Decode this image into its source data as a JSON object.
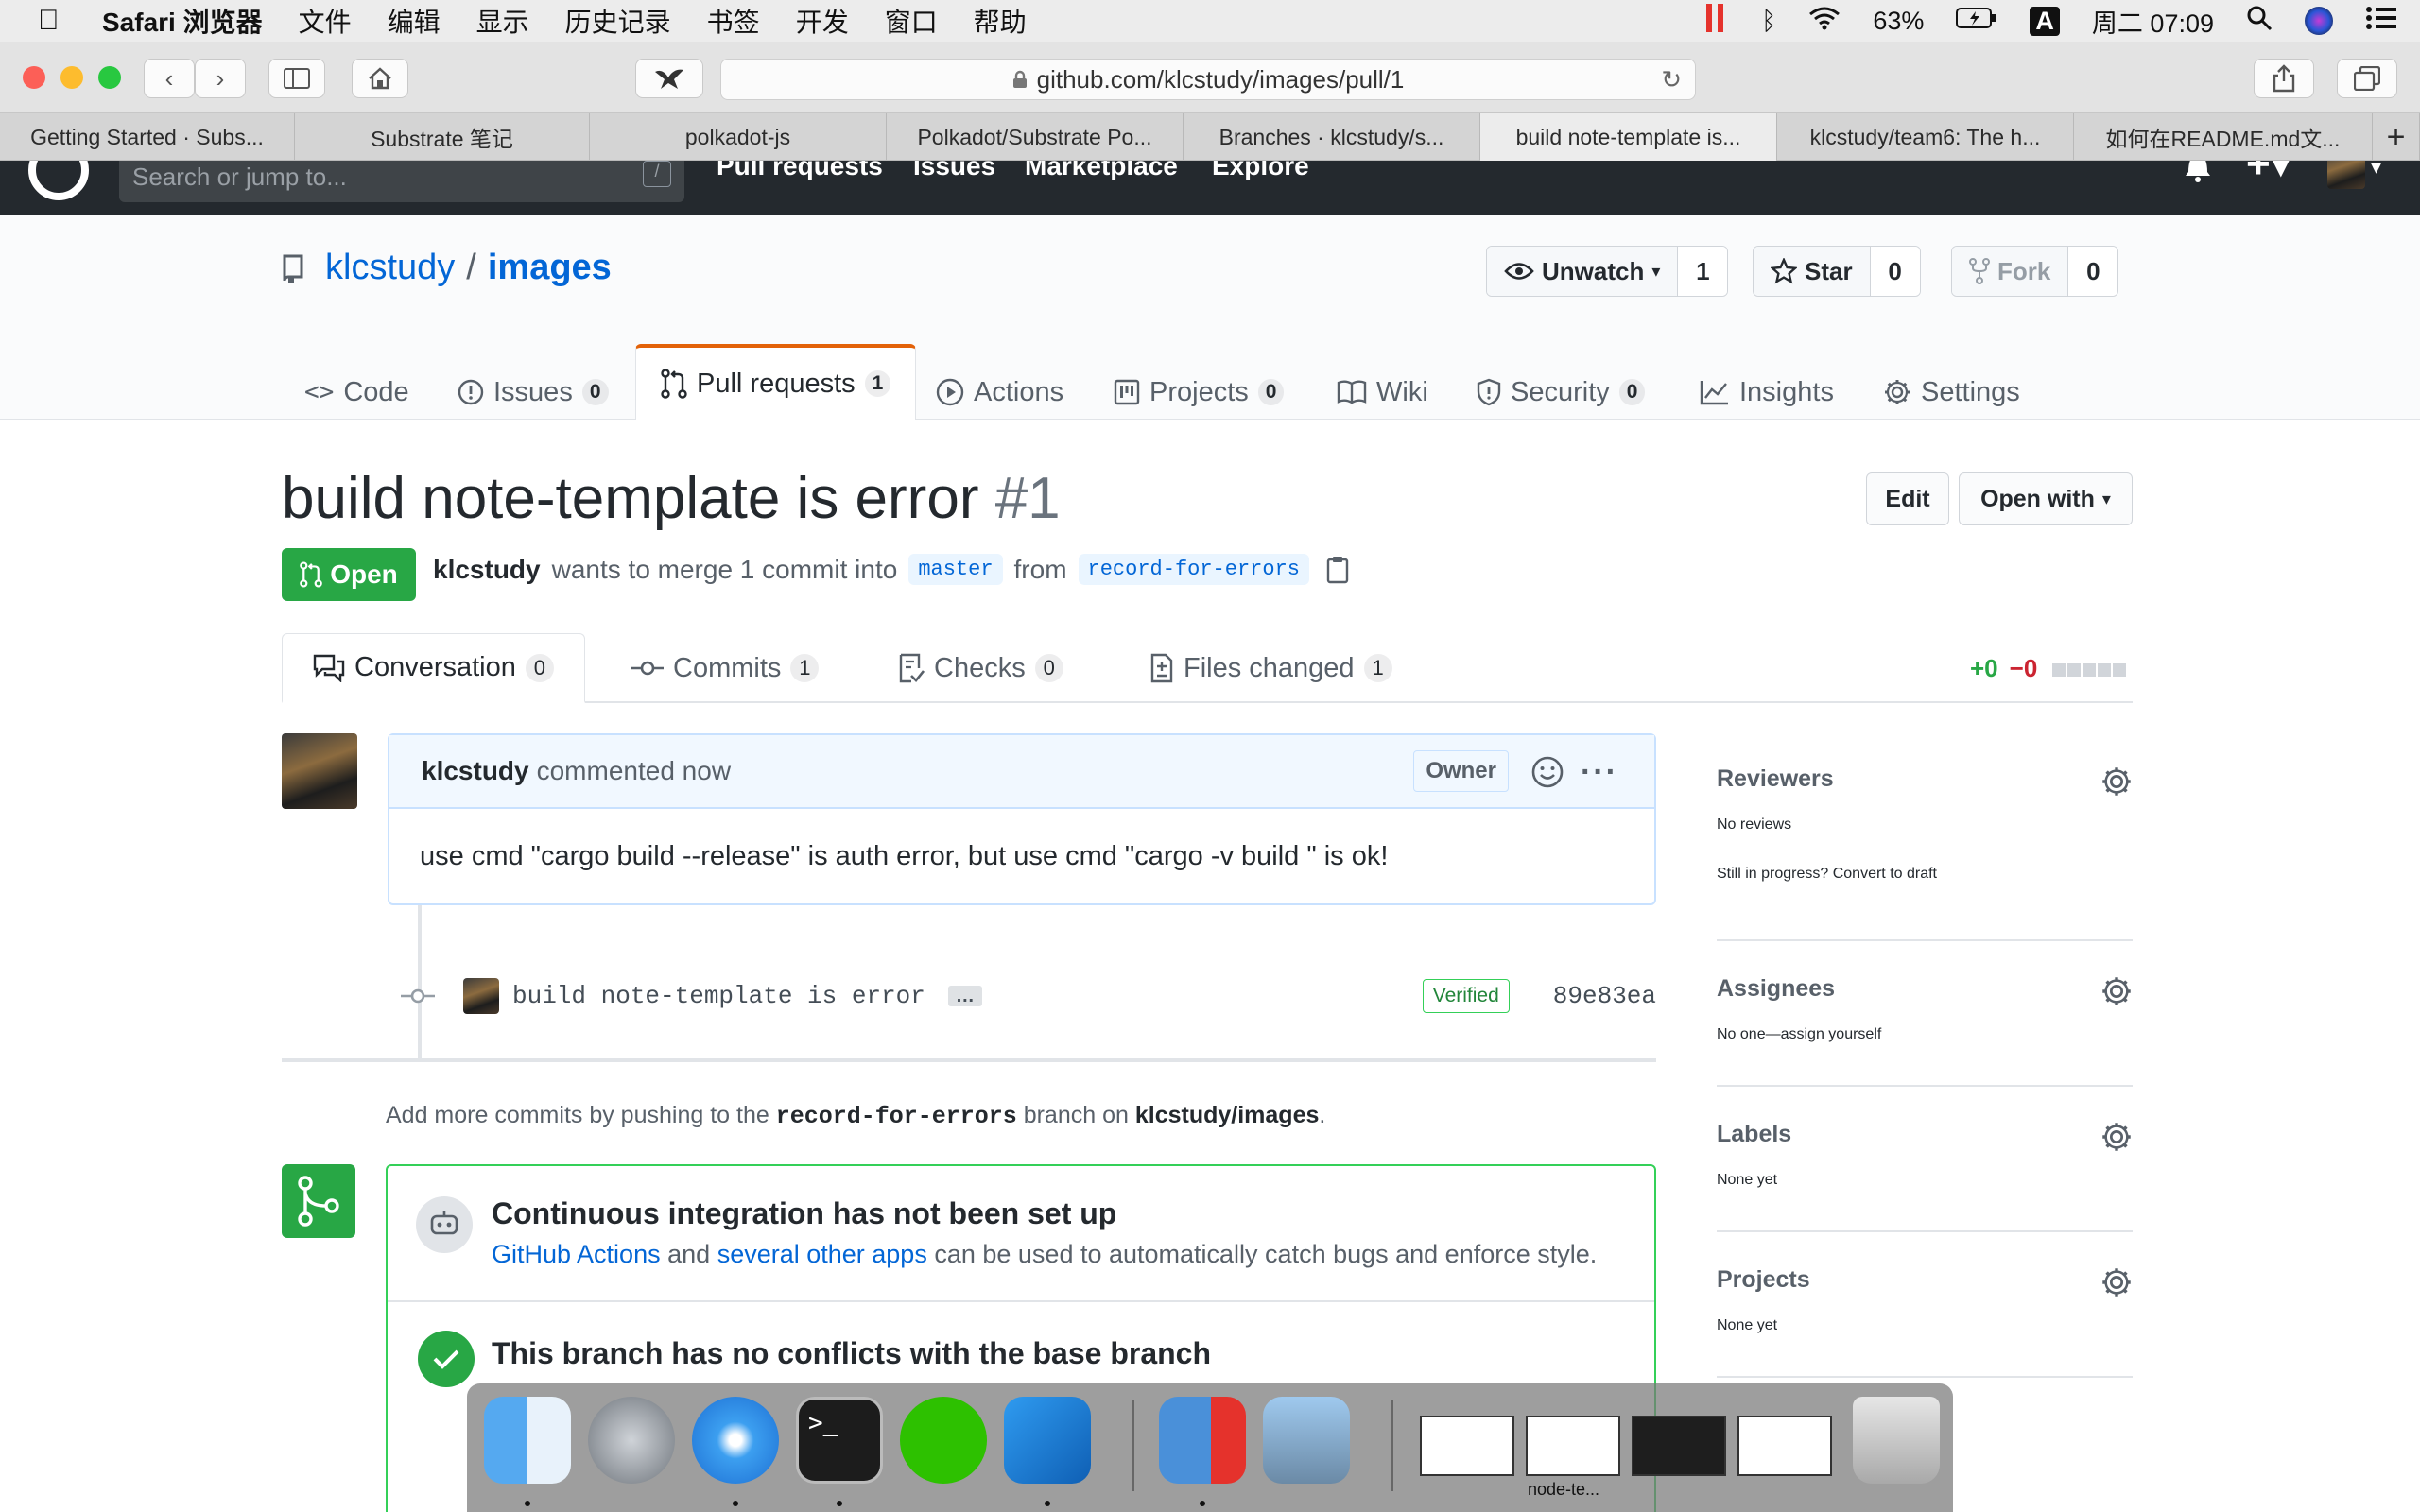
{
  "menubar": {
    "app_name": "Safari 浏览器",
    "items": [
      "文件",
      "编辑",
      "显示",
      "历史记录",
      "书签",
      "开发",
      "窗口",
      "帮助"
    ],
    "battery": "63%",
    "input_method": "A",
    "clock": "周二 07:09"
  },
  "browser": {
    "url": "github.com/klcstudy/images/pull/1",
    "tabs": [
      "Getting Started · Subs...",
      "Substrate 笔记",
      "polkadot-js",
      "Polkadot/Substrate Po...",
      "Branches · klcstudy/s...",
      "build note-template is...",
      "klcstudy/team6: The h...",
      "如何在README.md文..."
    ],
    "active_tab_index": 5
  },
  "github_header": {
    "search_placeholder": "Search or jump to...",
    "search_key": "/",
    "nav": [
      "Pull requests",
      "Issues",
      "Marketplace",
      "Explore"
    ]
  },
  "repo": {
    "owner": "klcstudy",
    "separator": "/",
    "name": "images",
    "watch_label": "Unwatch",
    "watch_count": "1",
    "star_label": "Star",
    "star_count": "0",
    "fork_label": "Fork",
    "fork_count": "0",
    "tabs": {
      "code": "Code",
      "issues": "Issues",
      "issues_count": "0",
      "pulls": "Pull requests",
      "pulls_count": "1",
      "actions": "Actions",
      "projects": "Projects",
      "projects_count": "0",
      "wiki": "Wiki",
      "security": "Security",
      "security_count": "0",
      "insights": "Insights",
      "settings": "Settings"
    }
  },
  "pr": {
    "title": "build note-template is error",
    "number": "#1",
    "edit_label": "Edit",
    "open_with_label": "Open with",
    "state": "Open",
    "author": "klcstudy",
    "merge_text": "wants to merge 1 commit into",
    "base_branch": "master",
    "from_text": "from",
    "head_branch": "record-for-errors",
    "tabs": {
      "conversation": "Conversation",
      "conversation_count": "0",
      "commits": "Commits",
      "commits_count": "1",
      "checks": "Checks",
      "checks_count": "0",
      "files": "Files changed",
      "files_count": "1"
    },
    "additions": "+0",
    "deletions": "−0"
  },
  "comment": {
    "author": "klcstudy",
    "time": "commented now",
    "role": "Owner",
    "body": "use cmd \"cargo build --release\" is auth error, but use cmd \"cargo -v build \" is ok!"
  },
  "commit": {
    "message": "build note-template is error",
    "ellipsis": "…",
    "verified": "Verified",
    "sha": "89e83ea"
  },
  "hint": {
    "prefix": "Add more commits by pushing to the",
    "branch": "record-for-errors",
    "middle": "branch on",
    "repo": "klcstudy/images",
    "suffix": "."
  },
  "merge_box": {
    "ci_title": "Continuous integration has not been set up",
    "ci_link1": "GitHub Actions",
    "ci_and": "and",
    "ci_link2": "several other apps",
    "ci_rest": "can be used to automatically catch bugs and enforce style.",
    "ok_title": "This branch has no conflicts with the base branch"
  },
  "sidebar": {
    "reviewers_title": "Reviewers",
    "reviewers_value": "No reviews",
    "reviewers_extra": "Still in progress? Convert to draft",
    "assignees_title": "Assignees",
    "assignees_value": "No one—assign yourself",
    "labels_title": "Labels",
    "labels_value": "None yet",
    "projects_title": "Projects",
    "projects_value": "None yet"
  },
  "dock": {
    "preview_label": "node-te..."
  }
}
